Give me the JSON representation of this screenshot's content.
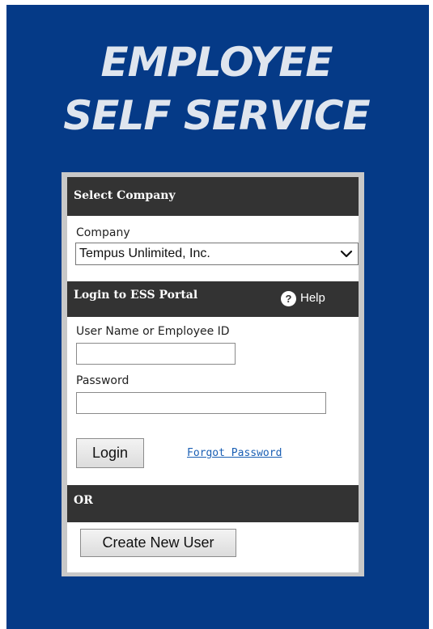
{
  "header": {
    "title_line1": "EMPLOYEE",
    "title_line2": "SELF SERVICE"
  },
  "company_section": {
    "heading": "Select Company",
    "company_label": "Company",
    "selected_company": "Tempus Unlimited, Inc."
  },
  "login_section": {
    "heading": "Login to ESS Portal",
    "help_label": "Help",
    "help_icon_glyph": "?",
    "username_label": "User Name or Employee ID",
    "username_value": "",
    "password_label": "Password",
    "password_value": "",
    "login_button": "Login",
    "forgot_password_link": "Forgot Password"
  },
  "or_section": {
    "heading": "OR",
    "create_user_button": "Create New User"
  },
  "colors": {
    "panel_blue": "#053a87",
    "section_dark": "#333333",
    "link_blue": "#1a5fb4",
    "title_text": "#dfe5ee"
  }
}
